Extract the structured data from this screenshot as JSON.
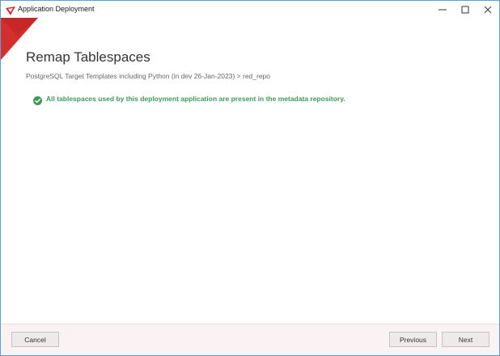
{
  "window": {
    "title": "Application Deployment",
    "icon": "app-logo-icon",
    "controls": [
      "minimize-icon",
      "maximize-icon",
      "close-icon"
    ]
  },
  "page": {
    "title": "Remap Tablespaces",
    "breadcrumb": "PostgreSQL Target Templates including Python (in dev 26-Jan-2023) > red_repo"
  },
  "status": {
    "icon": "check-circle-icon",
    "message": "All tablespaces used by this deployment application are present in the metadata repository.",
    "color": "#3d9a55"
  },
  "footer": {
    "cancel_label": "Cancel",
    "previous_label": "Previous",
    "next_label": "Next"
  },
  "colors": {
    "accent": "#d32f2f",
    "success": "#3d9a55",
    "window_border": "#5a9fd4"
  }
}
